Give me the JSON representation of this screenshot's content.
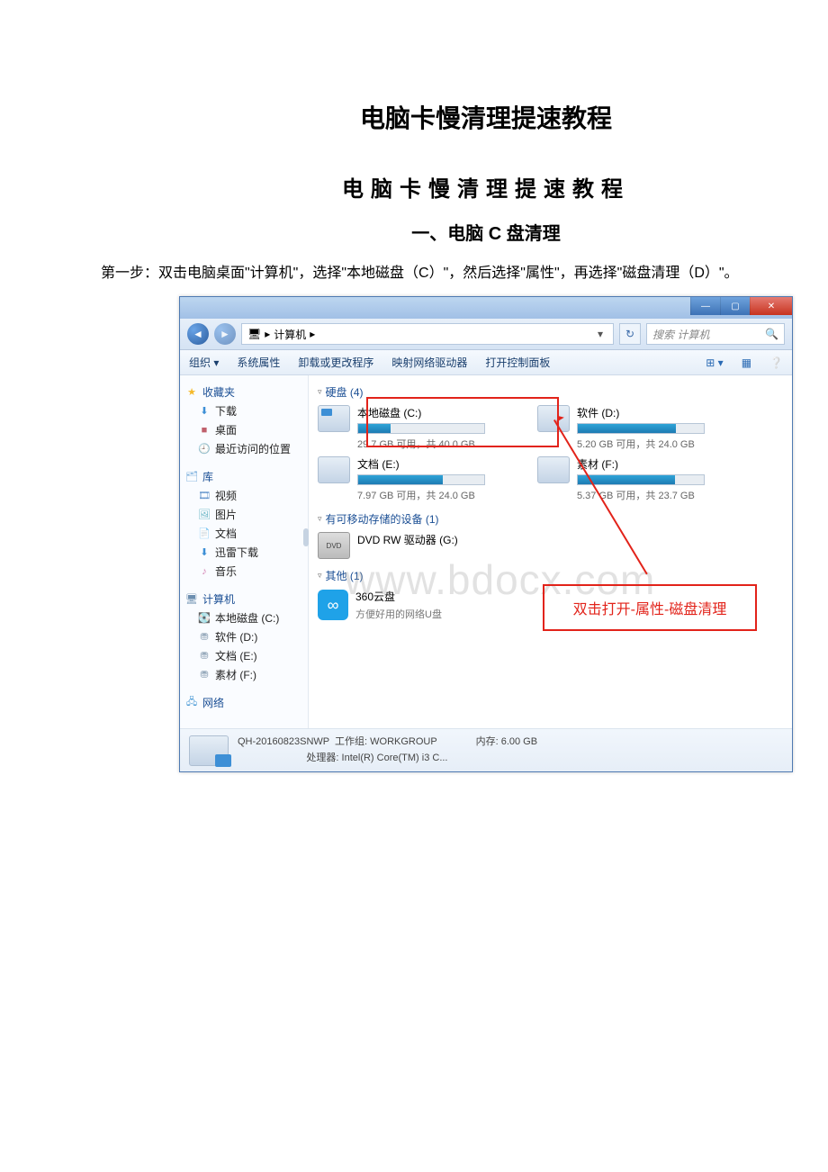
{
  "doc": {
    "title": "电脑卡慢清理提速教程",
    "subtitle": "电脑卡慢清理提速教程",
    "section1": "一、电脑 C 盘清理",
    "step1": "第一步：双击电脑桌面\"计算机\"，选择\"本地磁盘（C）\"，然后选择\"属性\"，再选择\"磁盘清理（D）\"。"
  },
  "watermark": "www.bdocx.com",
  "window": {
    "address": {
      "computer_icon": "🖥",
      "path1": "计算机",
      "sep": "▸"
    },
    "search_placeholder": "搜索 计算机",
    "toolbar": {
      "organize": "组织 ▾",
      "sys_props": "系统属性",
      "uninstall": "卸载或更改程序",
      "map_drive": "映射网络驱动器",
      "open_cp": "打开控制面板"
    },
    "sidebar": {
      "favorites": "收藏夹",
      "downloads": "下载",
      "desktop": "桌面",
      "recent": "最近访问的位置",
      "libraries": "库",
      "videos": "视频",
      "pictures": "图片",
      "documents": "文档",
      "thunder": "迅雷下载",
      "music": "音乐",
      "computer": "计算机",
      "drive_c": "本地磁盘 (C:)",
      "drive_d": "软件 (D:)",
      "drive_e": "文档 (E:)",
      "drive_f": "素材 (F:)",
      "network": "网络"
    },
    "main": {
      "group_hdd": "硬盘 (4)",
      "group_removable": "有可移动存储的设备 (1)",
      "group_other": "其他 (1)",
      "drives": {
        "c": {
          "name": "本地磁盘 (C:)",
          "meta": "29.7 GB 可用，共 40.0 GB",
          "fill": 26
        },
        "d": {
          "name": "软件 (D:)",
          "meta": "5.20 GB 可用，共 24.0 GB",
          "fill": 78
        },
        "e": {
          "name": "文档 (E:)",
          "meta": "7.97 GB 可用，共 24.0 GB",
          "fill": 67
        },
        "f": {
          "name": "素材 (F:)",
          "meta": "5.37 GB 可用，共 23.7 GB",
          "fill": 77
        }
      },
      "dvd": "DVD RW 驱动器 (G:)",
      "cloud": {
        "name": "360云盘",
        "desc": "方便好用的网络U盘"
      }
    },
    "callout": "双击打开-属性-磁盘清理",
    "details": {
      "name": "QH-20160823SNWP",
      "workgroup_label": "工作组:",
      "workgroup": "WORKGROUP",
      "cpu_label": "处理器:",
      "cpu": "Intel(R) Core(TM) i3 C...",
      "mem_label": "内存:",
      "mem": "6.00 GB"
    }
  }
}
